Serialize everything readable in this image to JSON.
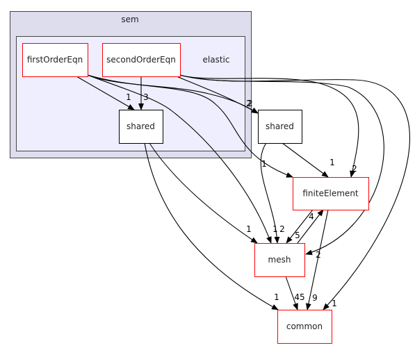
{
  "clusters": {
    "sem": {
      "label": "sem"
    },
    "elastic": {
      "label": "elastic"
    }
  },
  "nodes": {
    "firstOrderEqn": {
      "label": "firstOrderEqn",
      "border": "#ff0000"
    },
    "secondOrderEqn": {
      "label": "secondOrderEqn",
      "border": "#ff0000"
    },
    "shared_inner": {
      "label": "shared",
      "border": "#000000"
    },
    "shared_outer": {
      "label": "shared",
      "border": "#000000"
    },
    "finiteElement": {
      "label": "finiteElement",
      "border": "#ff0000"
    },
    "mesh": {
      "label": "mesh",
      "border": "#ff0000"
    },
    "common": {
      "label": "common",
      "border": "#ff0000"
    }
  },
  "edges": [
    {
      "from": "firstOrderEqn",
      "to": "shared_inner",
      "label": "1"
    },
    {
      "from": "secondOrderEqn",
      "to": "shared_inner",
      "label": "3"
    },
    {
      "from": "firstOrderEqn",
      "to": "shared_outer",
      "label": "2"
    },
    {
      "from": "secondOrderEqn",
      "to": "shared_outer",
      "label": "2"
    },
    {
      "from": "firstOrderEqn",
      "to": "finiteElement",
      "label": "1"
    },
    {
      "from": "firstOrderEqn",
      "to": "mesh",
      "label": "1"
    },
    {
      "from": "secondOrderEqn",
      "to": "finiteElement",
      "label": "2"
    },
    {
      "from": "secondOrderEqn",
      "to": "mesh",
      "label": "2"
    },
    {
      "from": "secondOrderEqn",
      "to": "common",
      "label": "1"
    },
    {
      "from": "shared_inner",
      "to": "mesh",
      "label": "1"
    },
    {
      "from": "shared_inner",
      "to": "common",
      "label": "1"
    },
    {
      "from": "shared_outer",
      "to": "mesh",
      "label": "2"
    },
    {
      "from": "shared_outer",
      "to": "finiteElement",
      "label": "1"
    },
    {
      "from": "finiteElement",
      "to": "mesh",
      "label": "5"
    },
    {
      "from": "mesh",
      "to": "finiteElement",
      "label": "4"
    },
    {
      "from": "finiteElement",
      "to": "common",
      "label": "9"
    },
    {
      "from": "mesh",
      "to": "common",
      "label": "45"
    }
  ],
  "colors": {
    "sem_fill": "#ddddee",
    "elastic_fill": "#eeeeff",
    "cluster_border": "#444444"
  }
}
